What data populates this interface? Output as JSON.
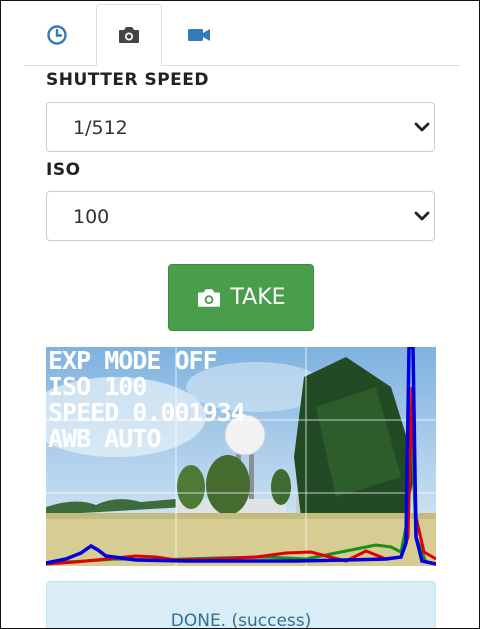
{
  "tabs": [
    {
      "icon": "clock-icon",
      "active": false
    },
    {
      "icon": "camera-icon",
      "active": true
    },
    {
      "icon": "video-camera-icon",
      "active": false
    }
  ],
  "shutter": {
    "label": "SHUTTER SPEED",
    "value": "1/512"
  },
  "iso": {
    "label": "ISO",
    "value": "100"
  },
  "take_button": {
    "label": "TAKE",
    "icon": "camera-icon"
  },
  "preview": {
    "overlay": [
      "EXP MODE OFF",
      "ISO 100",
      "SPEED 0.001934",
      "AWB AUTO"
    ],
    "histogram_colors": {
      "red": "#e00000",
      "green": "#1a8f1a",
      "blue": "#0000e0"
    }
  },
  "status": {
    "text": "DONE. (success)"
  },
  "colors": {
    "accent": "#337ab7",
    "take_button": "#4a9d4a",
    "alert_bg": "#d9edf7",
    "alert_text": "#31708f"
  }
}
